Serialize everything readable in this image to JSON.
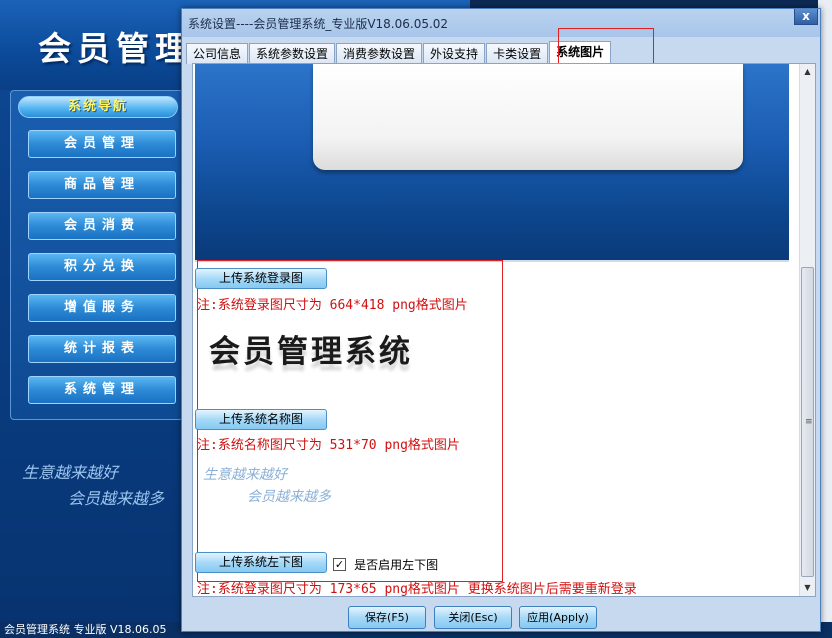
{
  "background": {
    "logo": "会员管理",
    "nav_title": "系统导航",
    "nav_items": [
      "会员管理",
      "商品管理",
      "会员消费",
      "积分兑换",
      "增值服务",
      "统计报表",
      "系统管理"
    ],
    "slogan_line1": "生意越来越好",
    "slogan_line2": "会员越来越多",
    "status": "会员管理系统 专业版 V18.06.05"
  },
  "dialog": {
    "title": "系统设置----会员管理系统_专业版V18.06.05.02",
    "close_label": "x",
    "tabs": [
      {
        "label": "公司信息",
        "active": false
      },
      {
        "label": "系统参数设置",
        "active": false
      },
      {
        "label": "消费参数设置",
        "active": false
      },
      {
        "label": "外设支持",
        "active": false
      },
      {
        "label": "卡类设置",
        "active": false
      },
      {
        "label": "系统图片",
        "active": true
      }
    ],
    "sections": {
      "login_upload_label": "上传系统登录图",
      "login_note": "注:系统登录图尺寸为 664*418 png格式图片",
      "name_upload_label": "上传系统名称图",
      "name_note": "注:系统名称图尺寸为 531*70 png格式图片",
      "name_image_text": "会员管理系统",
      "side_upload_label": "上传系统左下图",
      "side_enable_label": "是否启用左下图",
      "side_enable_checked": true,
      "side_note": "注:系统登录图尺寸为 173*65 png格式图片   更换系统图片后需要重新登录",
      "side_slogan_line1": "生意越来越好",
      "side_slogan_line2": "会员越来越多"
    },
    "buttons": {
      "save": "保存(F5)",
      "close": "关闭(Esc)",
      "apply": "应用(Apply)"
    }
  },
  "colors": {
    "accent_red": "#e02020",
    "note_red": "#d01010",
    "app_blue": "#0d4a96"
  }
}
